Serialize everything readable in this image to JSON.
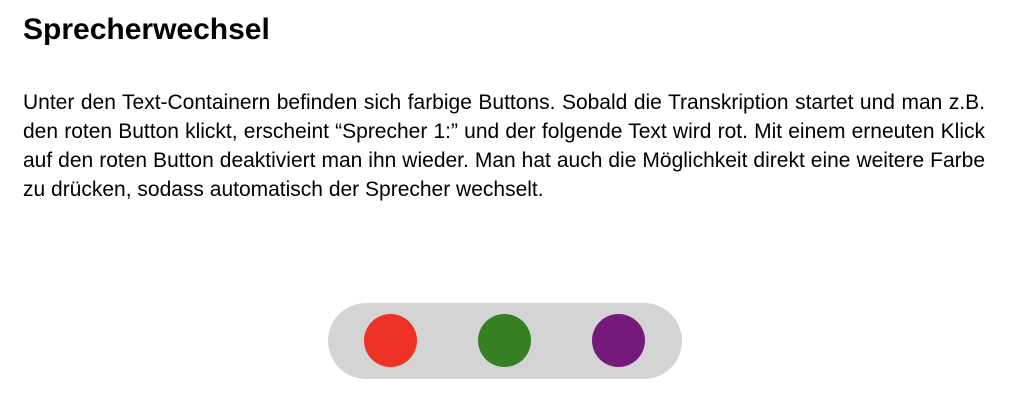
{
  "section": {
    "title": "Sprecherwechsel",
    "paragraph": "Unter den Text-Containern befinden sich farbige Buttons. Sobald die Transkription startet und man z.B. den roten Button klickt, erscheint “Sprecher 1:” und der folgende Text wird rot. Mit einem erneuten Klick auf den roten Button deaktiviert man ihn wieder. Man hat auch die Möglichkeit direkt eine weitere Farbe zu drücken, sodass automatisch der Sprecher wechselt."
  },
  "speaker_buttons": {
    "bar_color": "#d4d4d4",
    "items": [
      {
        "color": "#ee3326"
      },
      {
        "color": "#368023"
      },
      {
        "color": "#751a7c"
      }
    ]
  }
}
